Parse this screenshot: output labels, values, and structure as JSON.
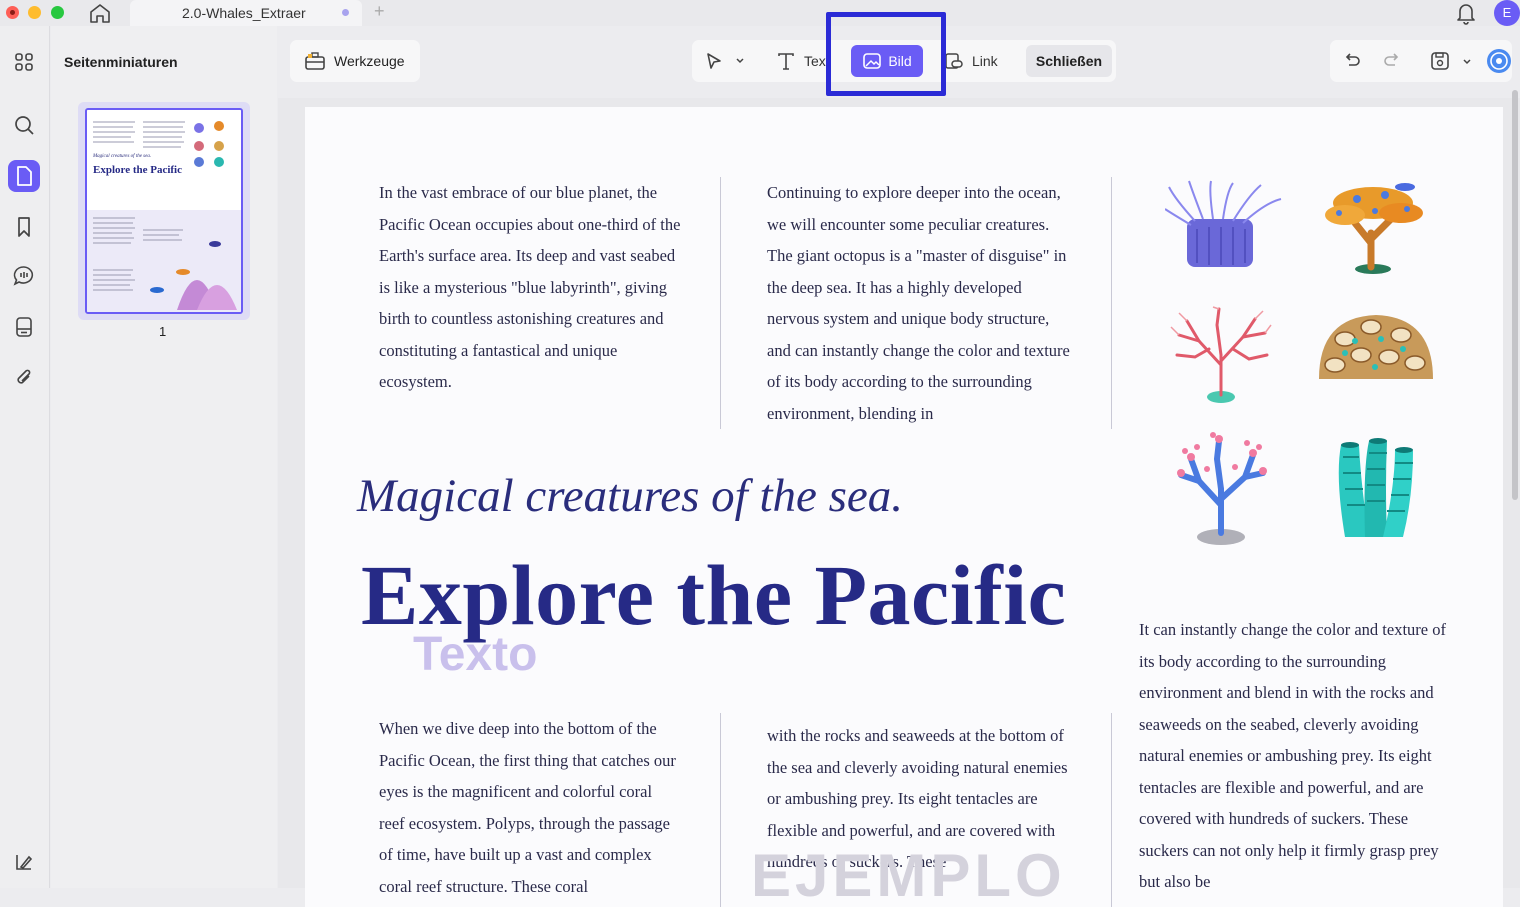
{
  "titlebar": {
    "tab_title": "2.0-Whales_Extraer",
    "avatar_letter": "E"
  },
  "sidebar": {
    "panel_title": "Seitenminiaturen",
    "page_number": "1",
    "thumb_subtitle": "Magical creatures of the sea.",
    "thumb_title": "Explore the Pacific"
  },
  "toolbar": {
    "tools_label": "Werkzeuge",
    "text_label": "Tex",
    "image_label": "Bild",
    "link_label": "Link",
    "close_label": "Schließen"
  },
  "document": {
    "col1_top": "In the vast embrace of our blue planet, the Pacific Ocean occupies about one-third of the Earth's surface area. Its deep and vast seabed is like a mysterious \"blue labyrinth\", giving birth to countless astonishing creatures and constituting a fantastical and unique ecosystem.",
    "col2_top": "Continuing to explore deeper into the ocean, we will encounter some peculiar creatures. The giant octopus is a \"master of disguise\" in the deep sea. It has a highly developed nervous system and unique body structure, and can instantly change the color and texture of its body according to the surrounding environment, blending in",
    "subtitle": "Magical creatures of the sea.",
    "title": "Explore the Pacific",
    "watermark_text": "Texto",
    "col3_right": "It can instantly change the color and texture of its body according to the surrounding environment and blend in with the rocks and seaweeds on the seabed, cleverly avoiding natural enemies or ambushing prey. Its eight tentacles are flexible and powerful, and are covered with hundreds of suckers. These suckers can not only help it firmly grasp prey but also be",
    "col1_bottom": "When we dive deep into the bottom of the Pacific Ocean, the first thing that catches our eyes is the magnificent and colorful coral reef ecosystem. Polyps, through the passage of time, have built up a vast and complex coral reef structure. These coral",
    "col2_bottom": "with the rocks and seaweeds at the bottom of the sea and cleverly avoiding natural enemies or ambushing prey. Its eight tentacles are flexible and powerful, and are covered with hundreds of suckers. These",
    "watermark_bottom": "EJEMPLO"
  },
  "icons": {
    "home": "home-icon",
    "bell": "bell-icon",
    "grid": "grid-icon",
    "search": "search-icon",
    "page": "page-icon",
    "bookmark": "bookmark-icon",
    "comment": "comment-icon",
    "form": "form-icon",
    "attachment": "paperclip-icon",
    "sidebar_toggle": "sidebar-toggle-icon"
  },
  "colors": {
    "accent": "#6a5cf5",
    "highlight_box": "#2b2bd6",
    "title_navy": "#262a86"
  }
}
